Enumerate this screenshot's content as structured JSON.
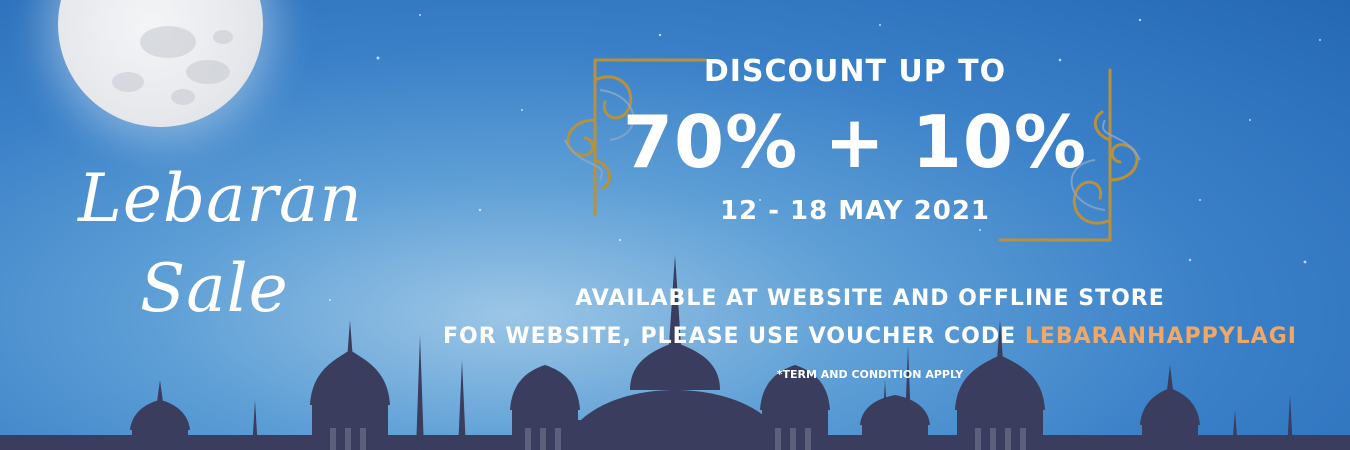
{
  "script": {
    "line1": "Lebaran",
    "line2": "Sale"
  },
  "headline": {
    "top": "DISCOUNT UP TO",
    "big": "70% + 10%",
    "date": "12 - 18 MAY 2021"
  },
  "info": {
    "line1": "AVAILABLE AT WEBSITE AND OFFLINE STORE",
    "line2_prefix": "FOR WEBSITE, PLEASE USE VOUCHER CODE ",
    "voucher_code": "LEBARANHAPPYLAGI",
    "terms": "*TERM AND CONDITION APPLY"
  },
  "colors": {
    "sky_dark": "#2468b4",
    "sky_light": "#9cc6e6",
    "mosque": "#3a3d5e",
    "voucher": "#f0a866",
    "ornament": "#b8913a"
  }
}
